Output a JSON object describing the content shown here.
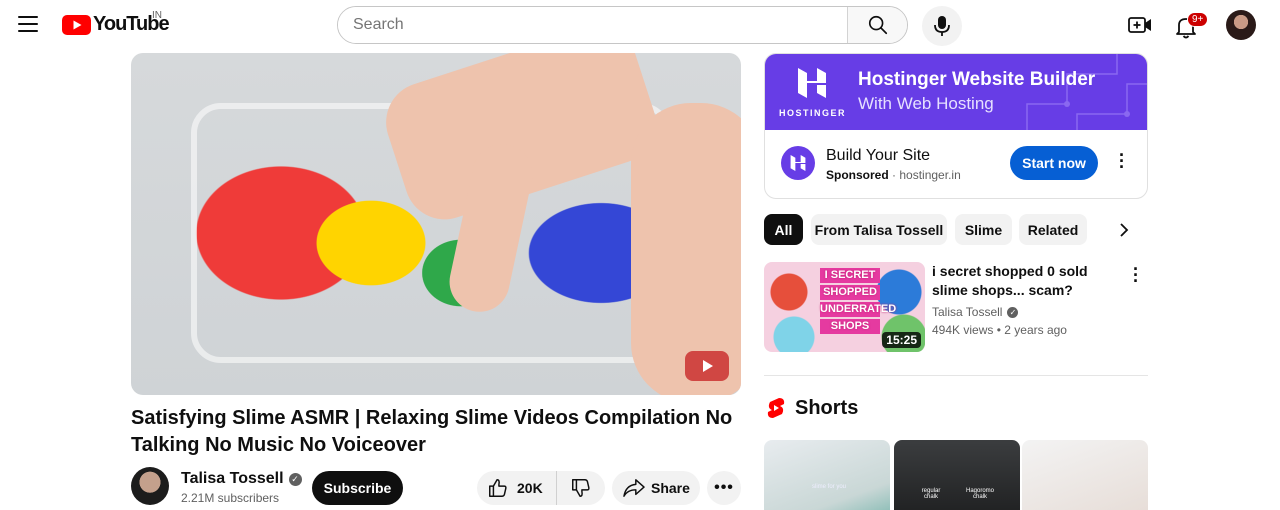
{
  "header": {
    "logo_text": "YouTube",
    "country_code": "IN",
    "search_placeholder": "Search",
    "notification_count": "9+"
  },
  "video": {
    "title": "Satisfying Slime ASMR | Relaxing Slime Videos Compilation No Talking No Music No Voiceover",
    "channel_name": "Talisa Tossell",
    "subscribers": "2.21M subscribers",
    "subscribe_label": "Subscribe",
    "likes": "20K",
    "share_label": "Share",
    "more_label": "•••"
  },
  "ad": {
    "banner_headline": "Hostinger Website Builder",
    "banner_subline": "With Web Hosting",
    "banner_brand": "HOSTINGER",
    "title": "Build Your Site",
    "sponsored_label": "Sponsored",
    "domain": "hostinger.in",
    "cta_label": "Start now",
    "accent_color": "#673de6",
    "cta_color": "#065fd4"
  },
  "chips": [
    {
      "label": "All",
      "active": true
    },
    {
      "label": "From Talisa Tossell",
      "active": false
    },
    {
      "label": "Slime",
      "active": false
    },
    {
      "label": "Related",
      "active": false
    }
  ],
  "related": [
    {
      "title": "i secret shopped 0 sold slime shops... scam?",
      "channel": "Talisa Tossell",
      "views": "494K views",
      "age": "2 years ago",
      "duration": "15:25",
      "thumb_text": [
        "I SECRET",
        "SHOPPED",
        "UNDERRATED",
        "SHOPS"
      ]
    }
  ],
  "shorts": {
    "title": "Shorts",
    "items": [
      {
        "caption": "slime for you"
      },
      {
        "caption": "regular chalk",
        "caption2": "Hagoromo chalk"
      },
      {
        "caption": ""
      }
    ]
  }
}
